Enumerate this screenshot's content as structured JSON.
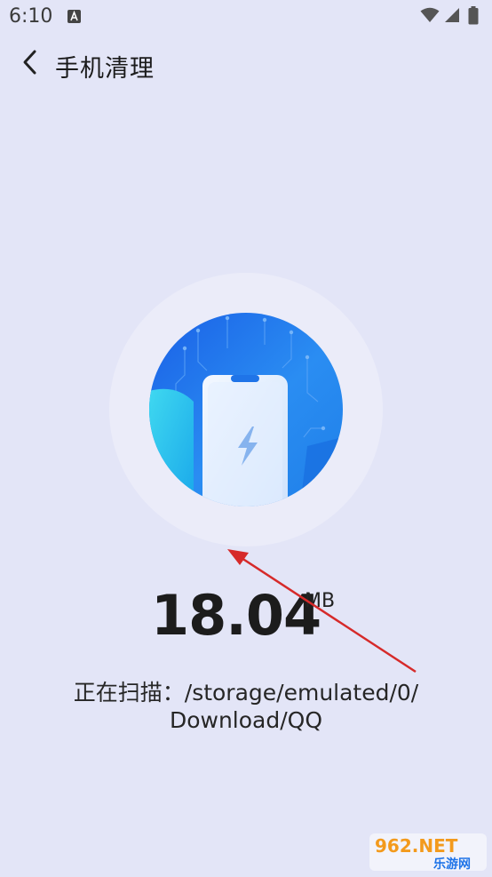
{
  "status_bar": {
    "time": "6:10",
    "icons": [
      "keyboard-a-icon",
      "wifi-icon",
      "signal-icon",
      "battery-icon"
    ]
  },
  "app_bar": {
    "back_icon": "chevron-left-icon",
    "title": "手机清理"
  },
  "scan": {
    "size_value": "18.04",
    "size_unit": "MB",
    "path_line1": "正在扫描：/storage/emulated/0/",
    "path_line2": "Download/QQ"
  },
  "watermark": {
    "text_top": "962.NET",
    "text_bottom": "乐游网"
  },
  "colors": {
    "background": "#e3e5f7",
    "accent_blue": "#1e73ee",
    "annotation_red": "#d62a2a"
  }
}
